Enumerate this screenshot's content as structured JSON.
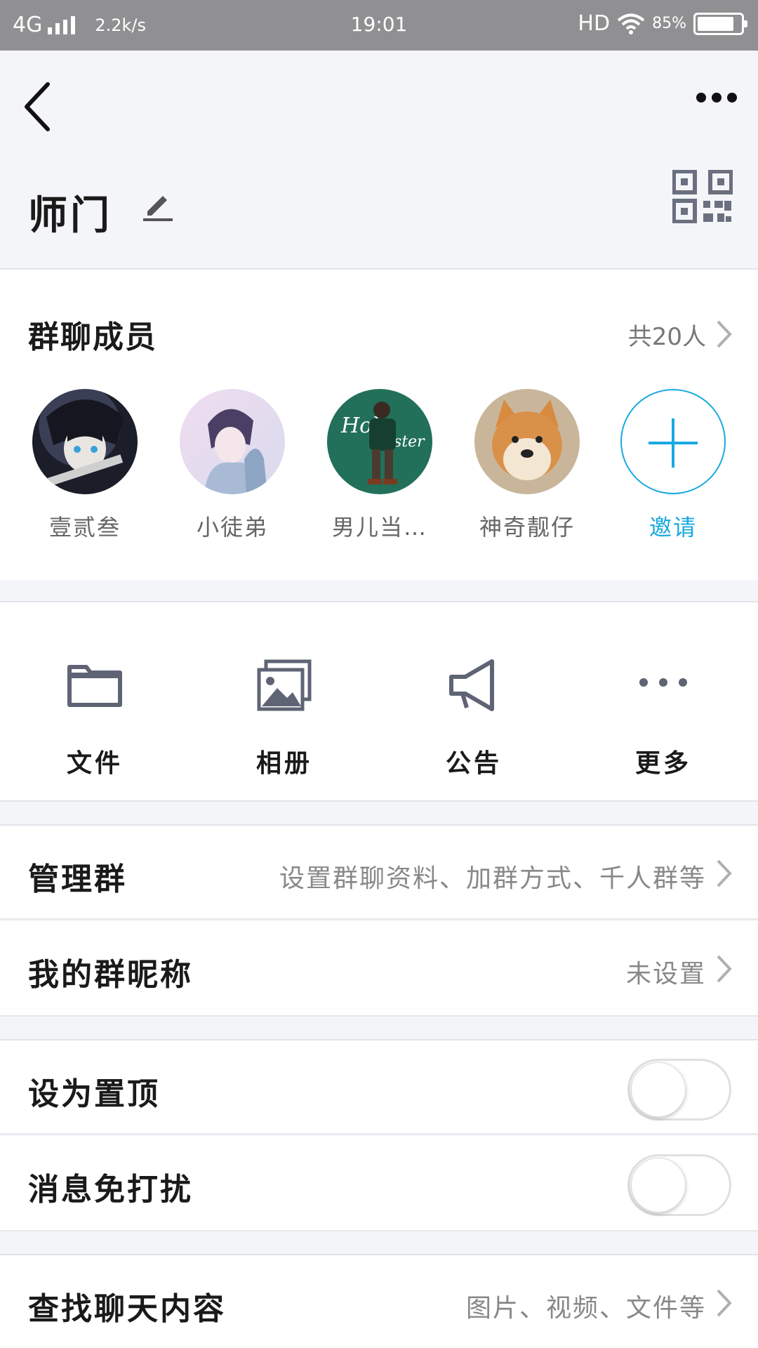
{
  "status_bar": {
    "network": "4G",
    "speed": "2.2k/s",
    "time": "19:01",
    "hd": "HD",
    "battery": "85%"
  },
  "nav": {
    "back_icon": "chevron-left-icon",
    "more_icon": "ellipsis-icon",
    "group_name": "师门",
    "edit_icon": "pencil-icon",
    "qr_icon": "qr-code-icon"
  },
  "members": {
    "title": "群聊成员",
    "count": "共20人",
    "list": [
      {
        "name": "壹贰叁"
      },
      {
        "name": "小徒弟"
      },
      {
        "name": "男儿当…"
      },
      {
        "name": "神奇靓仔"
      }
    ],
    "invite_label": "邀请"
  },
  "tools": [
    {
      "label": "文件",
      "icon": "folder-icon"
    },
    {
      "label": "相册",
      "icon": "album-icon"
    },
    {
      "label": "公告",
      "icon": "megaphone-icon"
    },
    {
      "label": "更多",
      "icon": "more-dots-icon"
    }
  ],
  "settings": {
    "manage": {
      "label": "管理群",
      "value": "设置群聊资料、加群方式、千人群等"
    },
    "nickname": {
      "label": "我的群昵称",
      "value": "未设置"
    },
    "pin_top": {
      "label": "设为置顶",
      "on": false
    },
    "mute": {
      "label": "消息免打扰",
      "on": false
    },
    "search": {
      "label": "查找聊天内容",
      "value": "图片、视频、文件等"
    }
  },
  "colors": {
    "accent": "#19a9e0",
    "status_bar": "#909092",
    "background": "#f4f5f8"
  }
}
